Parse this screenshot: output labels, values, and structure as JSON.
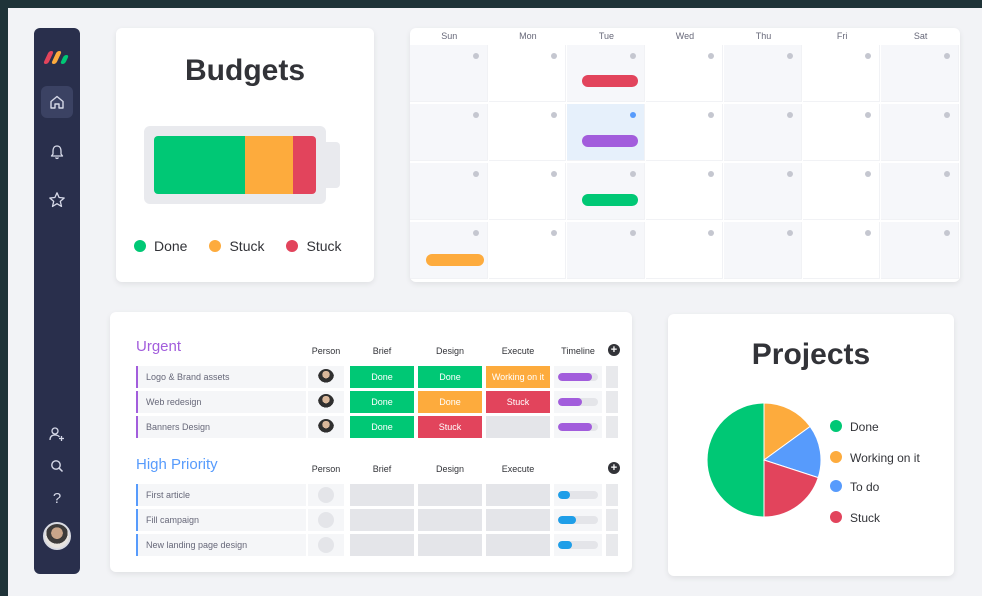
{
  "colors": {
    "done": "#00c875",
    "working": "#fdab3d",
    "stuck": "#e2445c",
    "todo": "#579bfc",
    "purple": "#a25ddc",
    "sidebar": "#292f4c"
  },
  "sidebar": {
    "icons": [
      "monday-logo-icon",
      "home-icon",
      "bell-icon",
      "star-icon",
      "add-user-icon",
      "search-icon",
      "help-icon"
    ]
  },
  "budgets": {
    "title": "Budgets",
    "segments": [
      {
        "status": "done",
        "fraction": 0.56
      },
      {
        "status": "working",
        "fraction": 0.3
      },
      {
        "status": "stuck",
        "fraction": 0.14
      }
    ],
    "legend": [
      {
        "label": "Done",
        "color": "#00c875"
      },
      {
        "label": "Stuck",
        "color": "#fdab3d"
      },
      {
        "label": "Stuck",
        "color": "#e2445c"
      }
    ]
  },
  "calendar": {
    "days": [
      "Sun",
      "Mon",
      "Tue",
      "Wed",
      "Thu",
      "Fri",
      "Sat"
    ]
  },
  "board": {
    "urgent": {
      "title": "Urgent",
      "columns": [
        "Person",
        "Brief",
        "Design",
        "Execute",
        "Timeline"
      ],
      "rows": [
        {
          "name": "Logo & Brand assets",
          "brief": "Done",
          "design": "Done",
          "execute": "Working on it",
          "timeline": 0.85
        },
        {
          "name": "Web redesign",
          "brief": "Done",
          "design": "Done",
          "execute": "Stuck",
          "timeline": 0.6
        },
        {
          "name": "Banners Design",
          "brief": "Done",
          "design": "Stuck",
          "execute": "",
          "timeline": 0.85
        }
      ]
    },
    "high": {
      "title": "High Priority",
      "columns": [
        "Person",
        "Brief",
        "Design",
        "Execute"
      ],
      "rows": [
        {
          "name": "First article",
          "timeline": 0.3
        },
        {
          "name": "Fill campaign",
          "timeline": 0.45
        },
        {
          "name": "New landing page design",
          "timeline": 0.35
        }
      ]
    }
  },
  "projects": {
    "title": "Projects",
    "slices": [
      {
        "label": "Done",
        "value": 0.5,
        "color": "#00c875"
      },
      {
        "label": "Working on it",
        "value": 0.15,
        "color": "#fdab3d"
      },
      {
        "label": "To do",
        "value": 0.15,
        "color": "#579bfc"
      },
      {
        "label": "Stuck",
        "value": 0.2,
        "color": "#e2445c"
      }
    ]
  }
}
